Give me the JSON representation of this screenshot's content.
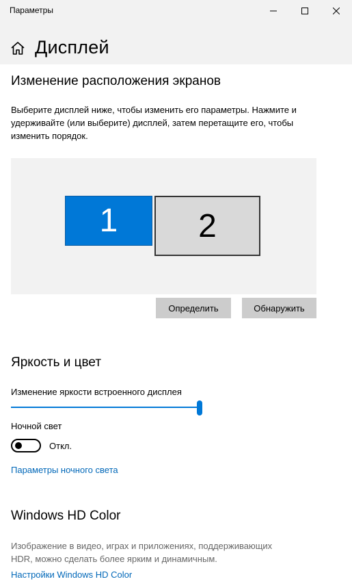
{
  "window": {
    "title": "Параметры"
  },
  "header": {
    "title": "Дисплей"
  },
  "arrange": {
    "heading": "Изменение расположения экранов",
    "description_lines": [
      "Выберите дисплей ниже, чтобы изменить его параметры. Нажмите и",
      "удерживайте (или выберите) дисплей, затем перетащите его, чтобы",
      "изменить порядок."
    ],
    "monitors": [
      {
        "label": "1",
        "selected": true
      },
      {
        "label": "2",
        "selected": false
      }
    ],
    "identify_label": "Определить",
    "detect_label": "Обнаружить"
  },
  "brightness": {
    "heading": "Яркость и цвет",
    "slider_label": "Изменение яркости встроенного дисплея",
    "slider_value_percent": 100,
    "night_light_label": "Ночной свет",
    "night_light_state": "Откл.",
    "night_light_link": "Параметры ночного света"
  },
  "hdr": {
    "heading": "Windows HD Color",
    "description_lines": [
      "Изображение в видео, играх и приложениях, поддерживающих",
      "HDR, можно сделать более ярким и динамичным."
    ],
    "link": "Настройки Windows HD Color"
  },
  "colors": {
    "accent": "#0078d7",
    "link": "#0067b8",
    "titlebar_bg": "#f2f2f2"
  }
}
